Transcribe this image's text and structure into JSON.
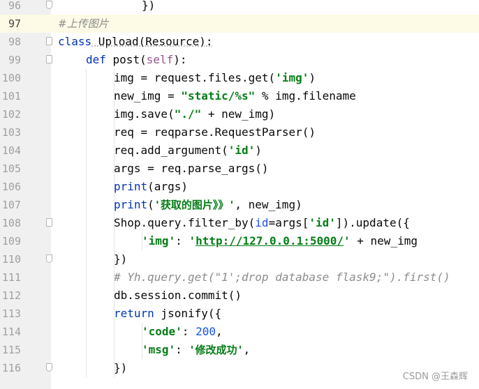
{
  "editor": {
    "line_numbers": [
      "96",
      "97",
      "98",
      "99",
      "100",
      "101",
      "102",
      "103",
      "104",
      "105",
      "106",
      "107",
      "108",
      "109",
      "110",
      "111",
      "112",
      "113",
      "114",
      "115",
      "116"
    ],
    "code": {
      "l96": "})",
      "l97": "#上传图片",
      "l98_kw": "class",
      "l98_rest": " Upload(Resource):",
      "l99_kw": "def",
      "l99_a": " post(",
      "l99_self": "self",
      "l99_b": "):",
      "l100_a": "img = request.files.get(",
      "l100_str": "'img'",
      "l100_b": ")",
      "l101_a": "new_img = ",
      "l101_str": "\"static/%s\"",
      "l101_b": " % img.filename",
      "l102_a": "img.save(",
      "l102_str": "\"./\"",
      "l102_b": " + new_img)",
      "l103": "req = reqparse.RequestParser()",
      "l104_a": "req.add_argument(",
      "l104_str": "'id'",
      "l104_b": ")",
      "l105": "args = req.parse_args()",
      "l106_kw": "print",
      "l106_b": "(args)",
      "l107_kw": "print",
      "l107_a": "(",
      "l107_str": "'获取的图片》》'",
      "l107_b": ", new_img)",
      "l108_a": "Shop.query.filter_by(",
      "l108_param": "id",
      "l108_b": "=args[",
      "l108_str": "'id'",
      "l108_c": "]).update({",
      "l109_str1": "'img'",
      "l109_a": ": ",
      "l109_q1": "'",
      "l109_link": "http://127.0.0.1:5000/",
      "l109_q2": "'",
      "l109_b": " + new_img",
      "l110": "})",
      "l111": "# Yh.query.get(\"1';drop database flask9;\").first()",
      "l112": "db.session.commit()",
      "l113_kw": "return",
      "l113_b": " jsonify({",
      "l114_str": "'code'",
      "l114_a": ": ",
      "l114_num": "200",
      "l114_b": ",",
      "l115_str1": "'msg'",
      "l115_a": ": ",
      "l115_str2": "'修改成功'",
      "l115_b": ",",
      "l116": "})"
    }
  },
  "colors": {
    "keyword": "#0033b3",
    "string": "#067d17",
    "number": "#1750eb",
    "self": "#94558d",
    "comment": "#8c8c8c",
    "current_line": "#fdfbe6"
  },
  "watermark": "CSDN @王森辉"
}
